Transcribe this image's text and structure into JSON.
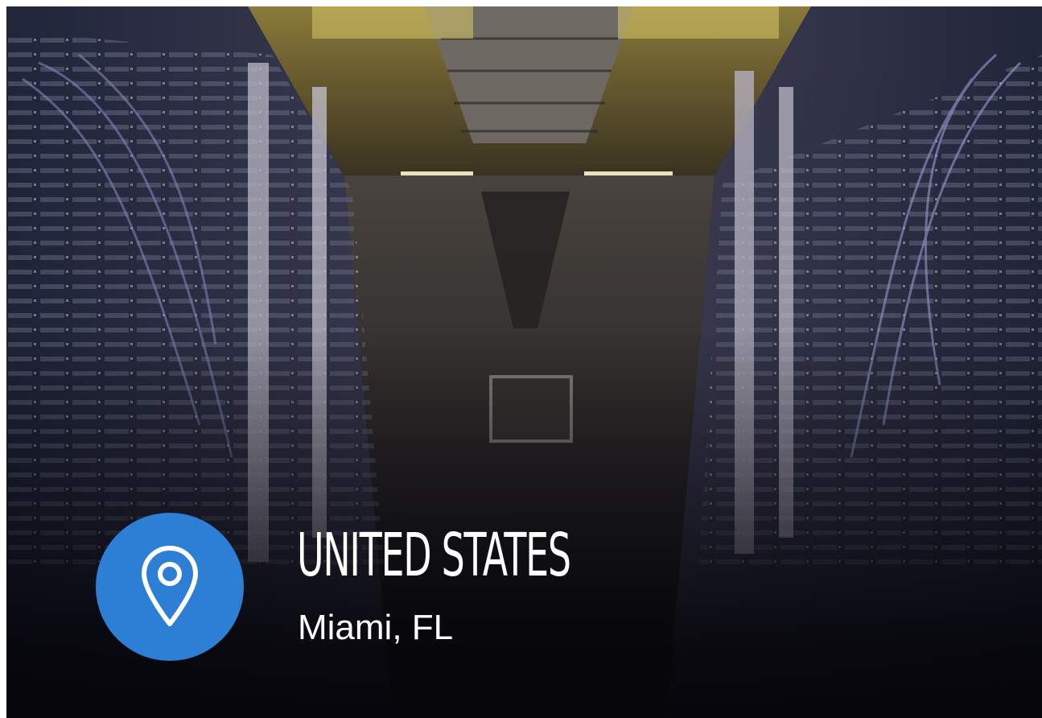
{
  "location": {
    "country": "UNITED STATES",
    "city": "Miami, FL",
    "icon": "map-pin-icon",
    "accent_color": "#2d7fd6"
  }
}
